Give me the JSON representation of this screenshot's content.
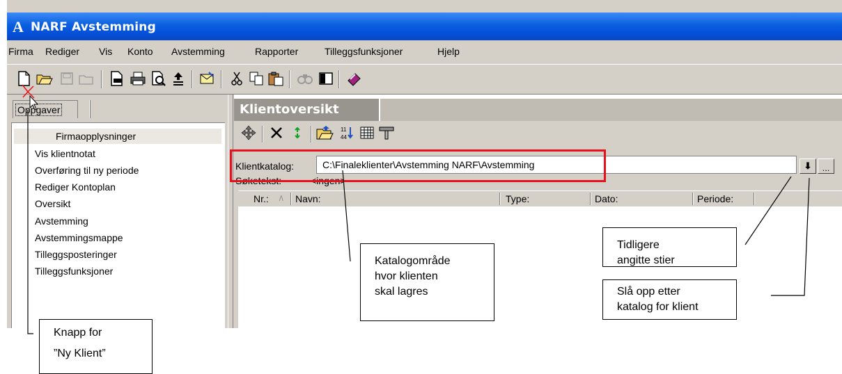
{
  "window": {
    "title": "NARF Avstemming",
    "logo_letter": "A"
  },
  "menu": [
    "Firma",
    "Rediger",
    "Vis",
    "Konto",
    "Avstemming",
    "Rapporter",
    "Tilleggsfunksjoner",
    "Hjelp"
  ],
  "toolbar_icons": [
    "new-document-icon",
    "open-folder-icon",
    "save-icon",
    "close-icon",
    "print-preview-icon",
    "print-icon",
    "zoom-icon",
    "export-icon",
    "mail-icon",
    "cut-icon",
    "copy-icon",
    "paste-icon",
    "find-icon",
    "panel-icon",
    "book-icon"
  ],
  "left_pane": {
    "tab_label": "Oppgaver",
    "tasks": [
      "Firmaopplysninger",
      "Vis klientnotat",
      "Overføring til ny periode",
      "Rediger Kontoplan",
      "Oversikt",
      "Avstemming",
      "Avstemmingsmappe",
      "Tilleggsposteringer",
      "Tilleggsfunksjoner"
    ]
  },
  "right_pane": {
    "tab_label": "Klientoversikt",
    "toolbar_icons": [
      "navigate-icon",
      "delete-icon",
      "refresh-icon",
      "open-folder-icon",
      "sort-icon",
      "grid-icon",
      "tools-icon"
    ],
    "catalog_label": "Klientkatalog:",
    "catalog_value": "C:\\Finaleklienter\\Avstemming NARF\\Avstemming",
    "dropdown_glyph": "⬇",
    "browse_glyph": "...",
    "search_label": "Søketekst:",
    "search_value": "<ingen>",
    "columns": [
      "Nr.:",
      "Navn:",
      "Type:",
      "Dato:",
      "Periode:"
    ],
    "sort_glyph": "/\\"
  },
  "annotations": {
    "new_client": [
      "Knapp for",
      "”Ny Klient”"
    ],
    "catalog_area": [
      "Katalogområde",
      "hvor klienten",
      "skal lagres"
    ],
    "previous_paths": [
      "Tidligere",
      "angitte stier"
    ],
    "browse_catalog": [
      "Slå opp etter",
      "katalog for klient"
    ]
  },
  "colors": {
    "highlight_red": "#e8101a",
    "title_blue": "#0a5fe0"
  }
}
